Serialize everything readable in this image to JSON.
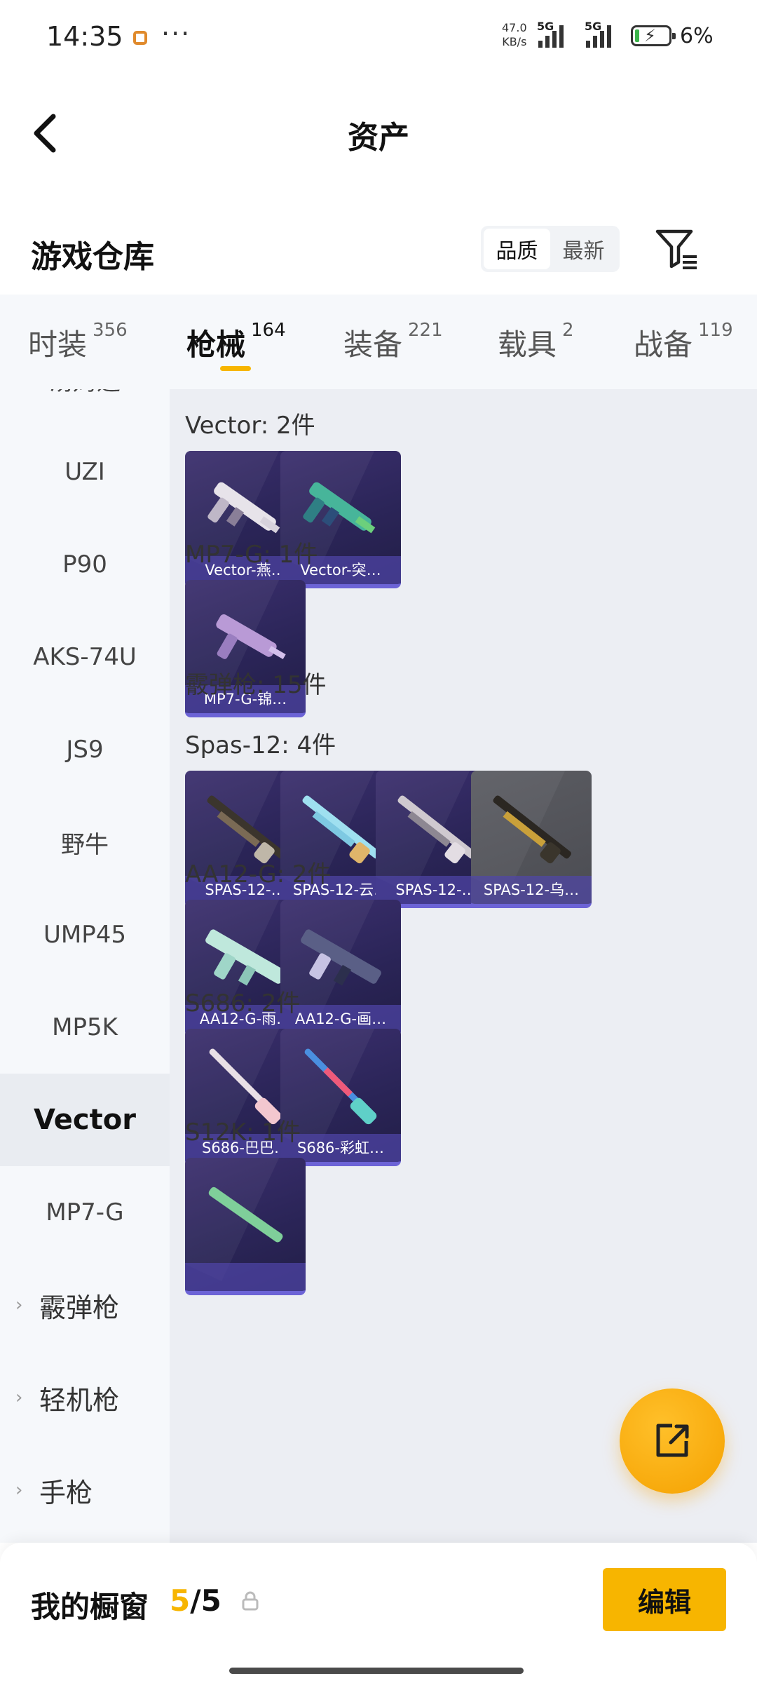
{
  "status": {
    "time": "14:35",
    "net_speed_value": "47.0",
    "net_speed_unit": "KB/s",
    "sim1": "5G",
    "sim2": "5G",
    "battery": "6%"
  },
  "header": {
    "title": "资产"
  },
  "section": {
    "title": "游戏仓库",
    "sort_options": [
      "品质",
      "最新"
    ],
    "sort_selected": "品质"
  },
  "tabs": [
    {
      "label": "时装",
      "count": "356"
    },
    {
      "label": "枪械",
      "count": "164",
      "active": true
    },
    {
      "label": "装备",
      "count": "221"
    },
    {
      "label": "载具",
      "count": "2"
    },
    {
      "label": "战备",
      "count": "119"
    }
  ],
  "sidebar": {
    "items": [
      {
        "label": "汤姆逊"
      },
      {
        "label": "UZI"
      },
      {
        "label": "P90"
      },
      {
        "label": "AKS-74U"
      },
      {
        "label": "JS9"
      },
      {
        "label": "野牛"
      },
      {
        "label": "UMP45"
      },
      {
        "label": "MP5K"
      },
      {
        "label": "Vector",
        "active": true
      },
      {
        "label": "MP7-G"
      },
      {
        "label": "霰弹枪",
        "group": true
      },
      {
        "label": "轻机枪",
        "group": true
      },
      {
        "label": "手枪",
        "group": true
      }
    ]
  },
  "content": {
    "groups": [
      {
        "title": "Vector: 2件",
        "items": [
          "Vector-燕…",
          "Vector-突…"
        ]
      },
      {
        "title": "MP7-G: 1件",
        "items": [
          "MP7-G-锦…"
        ]
      },
      {
        "title": "霰弹枪: 15件",
        "items": []
      },
      {
        "title": "Spas-12: 4件",
        "items": [
          "SPAS-12-…",
          "SPAS-12-云…",
          "SPAS-12-…",
          "SPAS-12-乌…"
        ]
      },
      {
        "title": "AA12-G: 2件",
        "items": [
          "AA12-G-雨…",
          "AA12-G-画…"
        ]
      },
      {
        "title": "S686: 2件",
        "items": [
          "S686-巴巴…",
          "S686-彩虹…"
        ]
      },
      {
        "title": "S12K: 1件",
        "items": [
          ""
        ]
      }
    ]
  },
  "bottom": {
    "showcase_label": "我的橱窗",
    "showcase_current": "5",
    "showcase_sep": "/",
    "showcase_total": "5",
    "edit_label": "编辑"
  },
  "colors": {
    "accent": "#f7b500",
    "card_bg": "#2b2558",
    "card_band": "#6c63d6"
  }
}
